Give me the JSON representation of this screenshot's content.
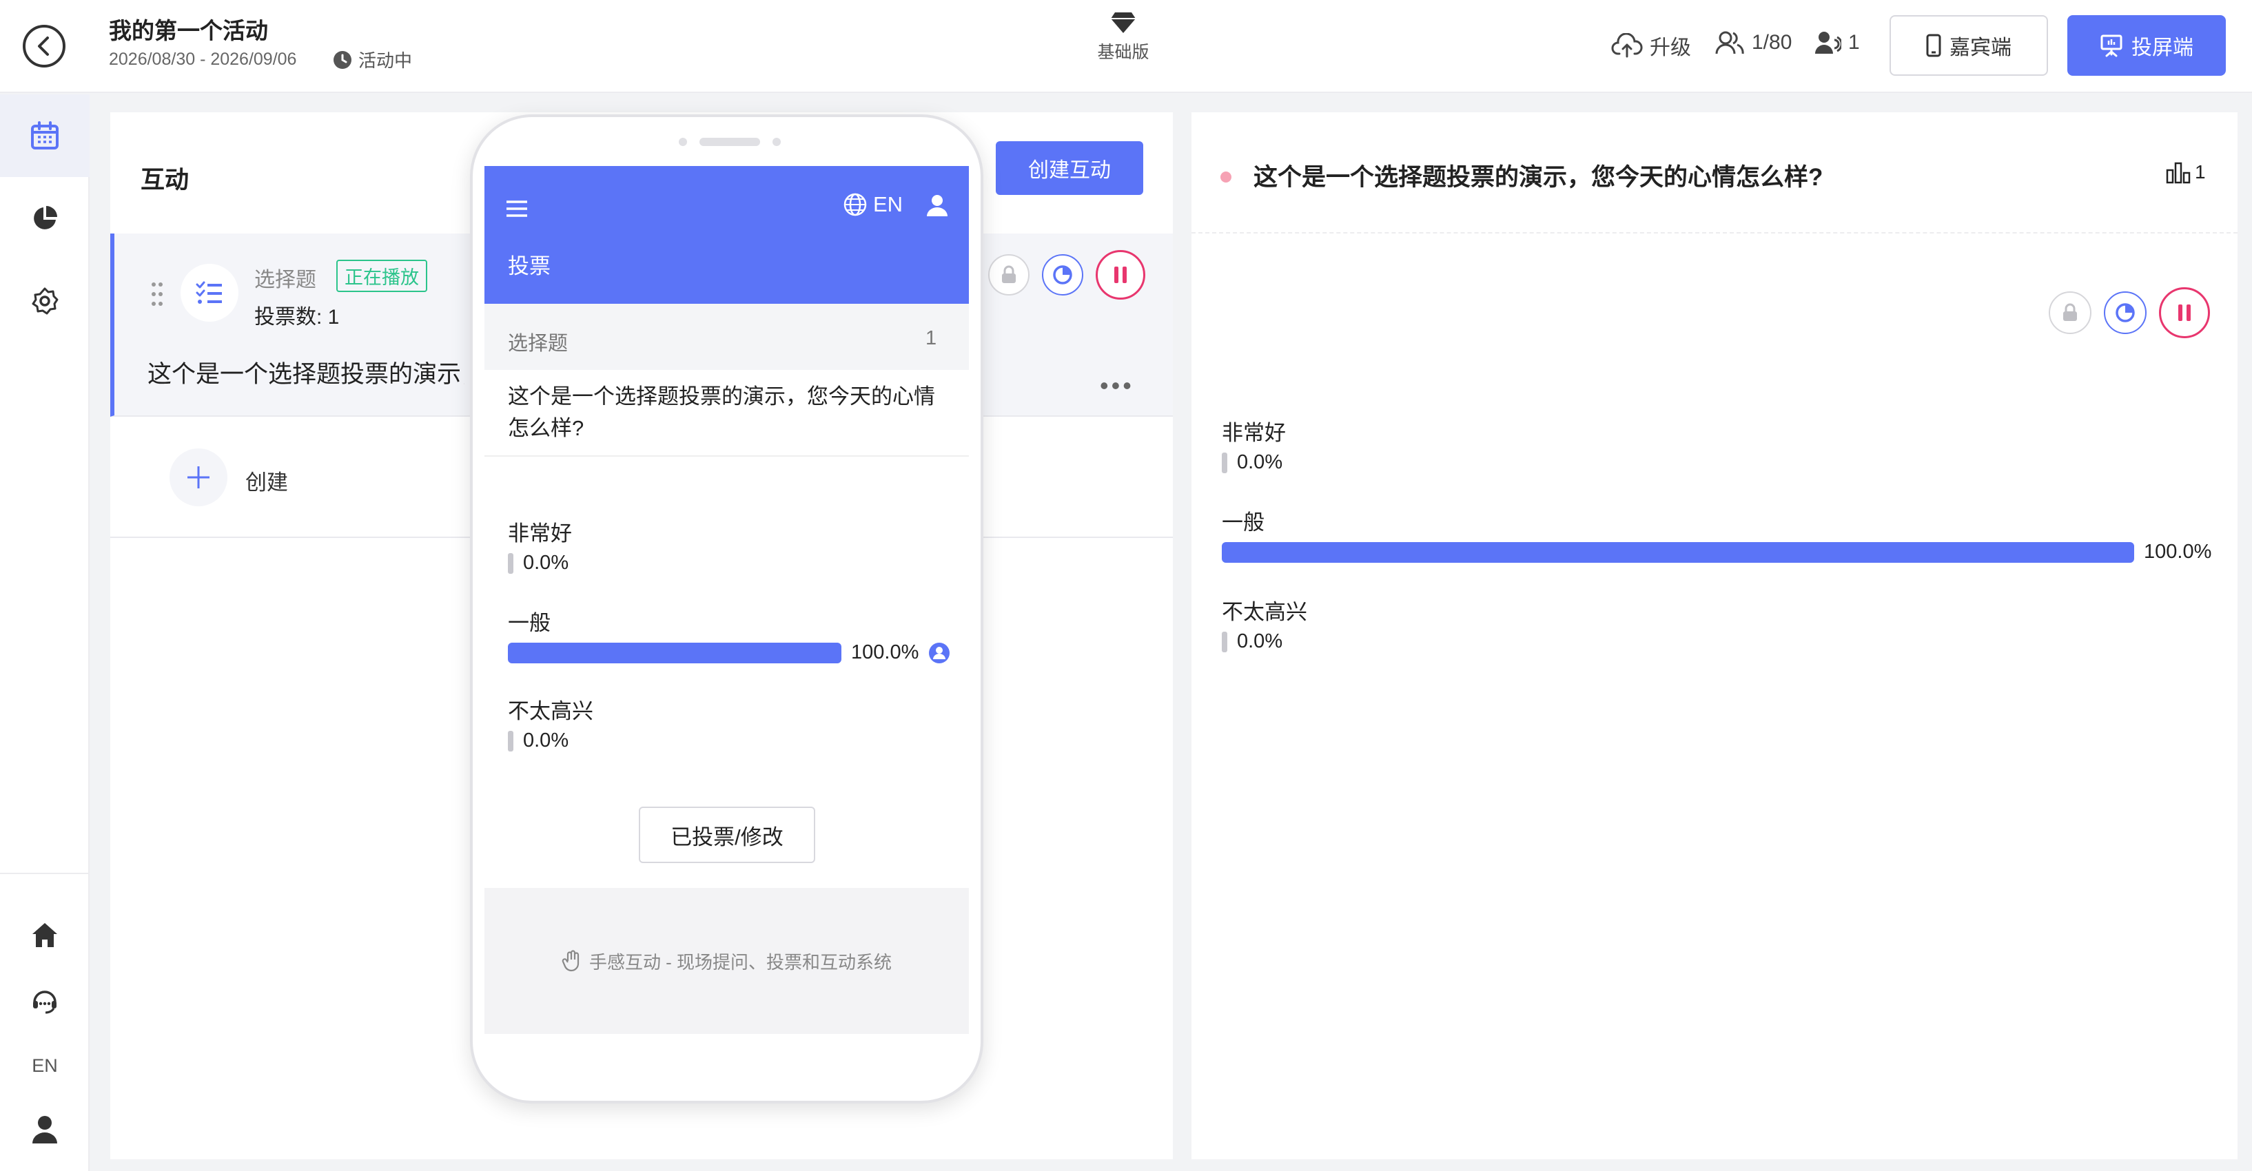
{
  "header": {
    "title": "我的第一个活动",
    "dates": "2026/08/30 - 2026/09/06",
    "status": "活动中",
    "plan": "基础版",
    "upgrade": "升级",
    "participants": "1/80",
    "online": "1",
    "guest_btn": "嘉宾端",
    "screen_btn": "投屏端"
  },
  "sidebar": {
    "items": [
      "calendar-icon",
      "pie-chart-icon",
      "settings-icon"
    ],
    "bottom": [
      "home-icon",
      "support-icon",
      "EN",
      "user-icon"
    ],
    "lang": "EN"
  },
  "interaction": {
    "title": "互动",
    "create_btn": "创建互动",
    "card": {
      "type": "选择题",
      "badge": "正在播放",
      "vote_count": "投票数: 1",
      "question": "这个是一个选择题投票的演示，"
    },
    "create_label": "创建"
  },
  "phone": {
    "lang": "EN",
    "title": "投票",
    "qtype": "选择题",
    "qnum": "1",
    "question": "这个是一个选择题投票的演示，您今天的心情怎么样?",
    "options": [
      {
        "label": "非常好",
        "pct": "0.0%",
        "value": 0.0
      },
      {
        "label": "一般",
        "pct": "100.0%",
        "value": 100.0
      },
      {
        "label": "不太高兴",
        "pct": "0.0%",
        "value": 0.0
      }
    ],
    "voted_btn": "已投票/修改",
    "footer": "手感互动 - 现场提问、投票和互动系统"
  },
  "results": {
    "question": "这个是一个选择题投票的演示，您今天的心情怎么样?",
    "chart_count": "1",
    "options": [
      {
        "label": "非常好",
        "pct": "0.0%",
        "value": 0.0
      },
      {
        "label": "一般",
        "pct": "100.0%",
        "value": 100.0
      },
      {
        "label": "不太高兴",
        "pct": "0.0%",
        "value": 0.0
      }
    ]
  },
  "colors": {
    "accent": "#5b74f7",
    "playing": "#2bc48b",
    "pause": "#e8366e"
  }
}
